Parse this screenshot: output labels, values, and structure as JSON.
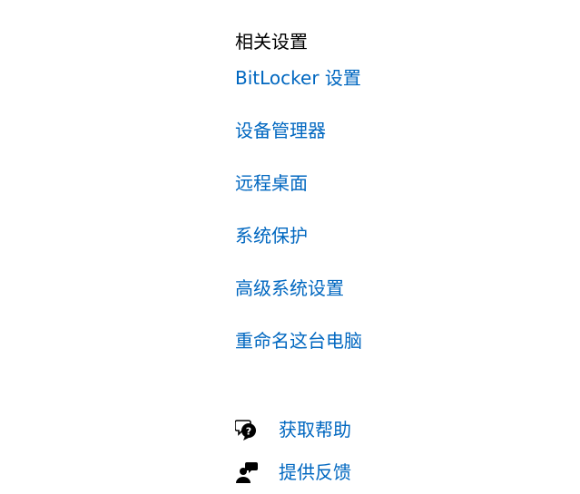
{
  "related_settings": {
    "title": "相关设置",
    "links": [
      {
        "label": "BitLocker 设置"
      },
      {
        "label": "设备管理器"
      },
      {
        "label": "远程桌面"
      },
      {
        "label": "系统保护"
      },
      {
        "label": "高级系统设置"
      },
      {
        "label": "重命名这台电脑"
      }
    ]
  },
  "help": {
    "get_help": {
      "label": "获取帮助",
      "icon": "get-help-icon"
    },
    "feedback": {
      "label": "提供反馈",
      "icon": "feedback-icon"
    }
  },
  "colors": {
    "link": "#0067c0",
    "text": "#000000",
    "background": "#ffffff"
  }
}
